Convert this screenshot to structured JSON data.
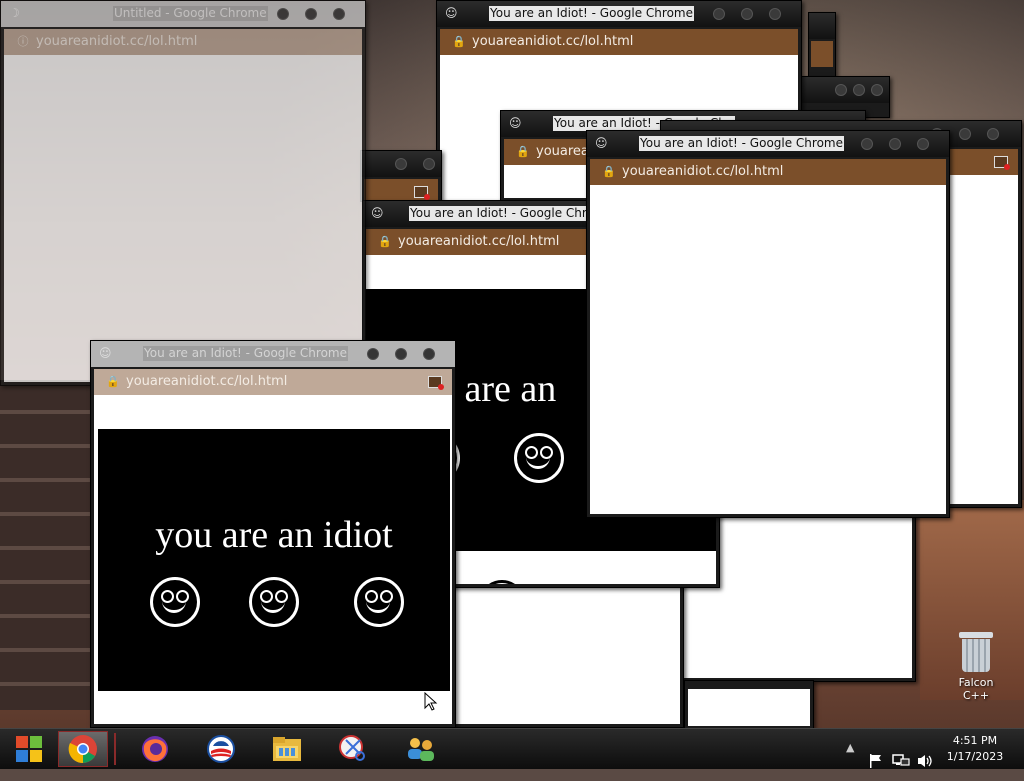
{
  "windows": {
    "untitled": {
      "title": "Untitled - Google Chrome",
      "url": "youareanidiot.cc/lol.html"
    },
    "generic": {
      "title": "You are an Idiot! - Google Chrome",
      "url": "youareanidiot.cc/lol.html"
    },
    "partial_title": "You are an Idiot! - Google Chr",
    "partial_title_short": "You are an Idiot! - Google Chrom"
  },
  "idiot_text": "you are an idiot",
  "idiot_text_partial": "u are an",
  "desktop_icon": {
    "label": "Falcon C++"
  },
  "clock": {
    "time": "4:51 PM",
    "date": "1/17/2023"
  },
  "taskbar_icons": [
    "start-orb-icon",
    "chrome-icon",
    "firefox-icon",
    "obama-logo-icon",
    "file-explorer-icon",
    "snipping-tool-icon",
    "users-icon"
  ],
  "colors": {
    "address_bar": "#7b4f2a",
    "taskbar": "#1a1a1a"
  }
}
